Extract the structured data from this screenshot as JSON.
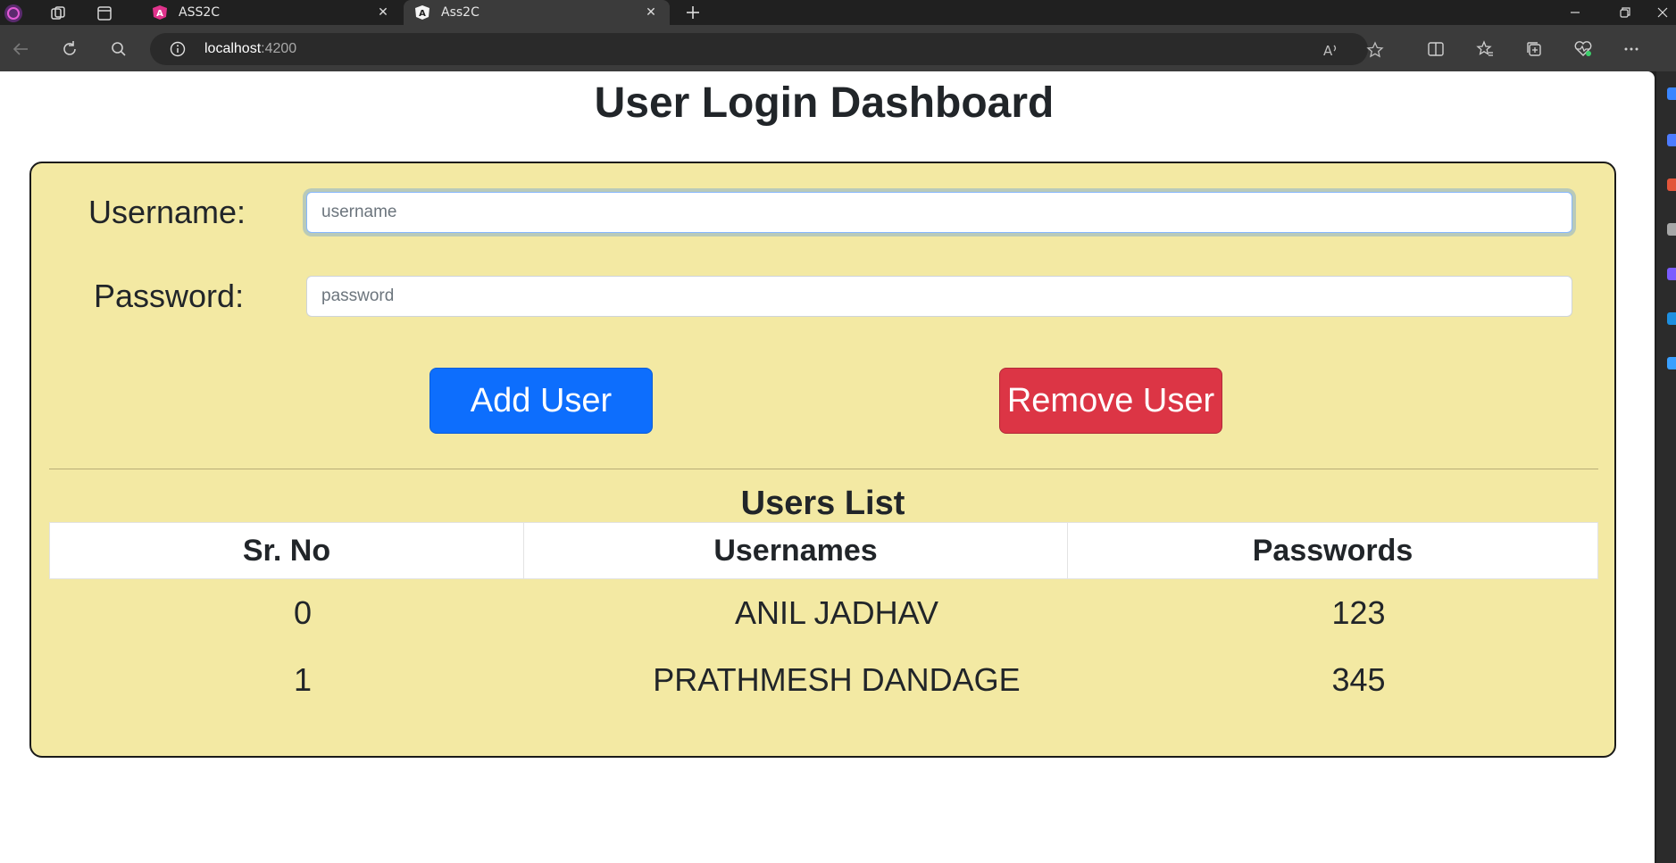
{
  "browser": {
    "tabs": [
      {
        "title": "ASS2C",
        "active": false,
        "favicon": "angular-pink-icon"
      },
      {
        "title": "Ass2C",
        "active": true,
        "favicon": "angular-white-icon"
      }
    ],
    "address": {
      "host": "localhost",
      "port": ":4200"
    }
  },
  "page": {
    "title": "User Login Dashboard",
    "form": {
      "username_label": "Username:",
      "username_placeholder": "username",
      "username_value": "",
      "password_label": "Password:",
      "password_placeholder": "password",
      "password_value": ""
    },
    "buttons": {
      "add_label": "Add User",
      "remove_label": "Remove User"
    },
    "list": {
      "title": "Users List",
      "columns": [
        "Sr. No",
        "Usernames",
        "Passwords"
      ],
      "rows": [
        [
          "0",
          "ANIL JADHAV",
          "123"
        ],
        [
          "1",
          "PRATHMESH DANDAGE",
          "345"
        ]
      ]
    }
  },
  "colors": {
    "card_bg": "#f3e9a3",
    "add_button": "#0d6efd",
    "remove_button": "#dc3545"
  }
}
